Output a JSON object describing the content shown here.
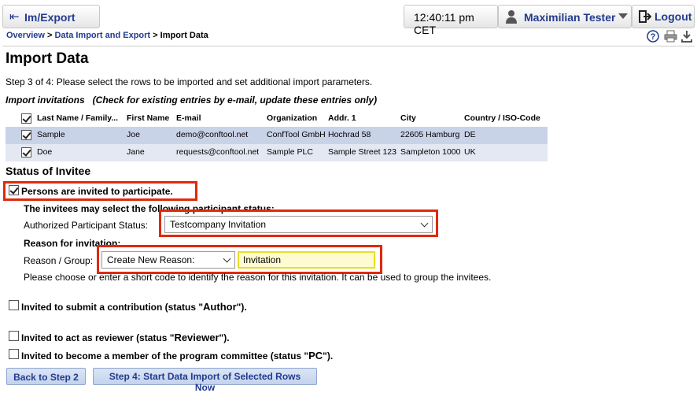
{
  "header": {
    "nav_label": "Im/Export",
    "time": "12:40:11 pm CET",
    "user_name": "Maximilian Tester",
    "logout_label": "Logout"
  },
  "breadcrumb": {
    "item1": "Overview",
    "sep1": " > ",
    "item2": "Data Import and Export",
    "sep2": " > ",
    "current": "Import Data"
  },
  "tools": [
    "help-icon",
    "print-icon",
    "download-icon"
  ],
  "page": {
    "title": "Import Data",
    "step_text": "Step 3 of 4: Please select the rows to be imported and set additional import parameters.",
    "section_title": "Import invitations   (Check for existing entries by e-mail, update these entries only)"
  },
  "table": {
    "columns": [
      "Last Name / Family...",
      "First Name",
      "E-mail",
      "Organization",
      "Addr. 1",
      "City",
      "Country / ISO-Code"
    ],
    "header_checked": true,
    "rows": [
      {
        "checked": true,
        "cells": [
          "Sample",
          "Joe",
          "demo@conftool.net",
          "ConfTool GmbH",
          "Hochrad 58",
          "22605 Hamburg",
          "DE"
        ]
      },
      {
        "checked": true,
        "cells": [
          "Doe",
          "Jane",
          "requests@conftool.net",
          "Sample PLC",
          "Sample Street 123",
          "Sampleton 1000",
          "UK"
        ]
      }
    ]
  },
  "status": {
    "title": "Status of Invitee",
    "participate": {
      "checked": true,
      "label": "Persons are invited to participate."
    },
    "may_select_text": "The invitees may select the following participant status:",
    "authorized_label": "Authorized Participant Status:",
    "authorized_value": "Testcompany Invitation",
    "reason_title": "Reason for invitation:",
    "reason_label": "Reason / Group:",
    "reason_select_value": "Create New Reason:",
    "reason_input_value": "Invitation",
    "reason_help": "Please choose or enter a short code to identify the reason for this invitation. It can be used to group the invitees.",
    "author": {
      "checked": false,
      "prefix": "Invited to submit a contribution (status \"",
      "status": "Author",
      "suffix": "\")."
    },
    "reviewer": {
      "checked": false,
      "prefix": "Invited to act as reviewer (status \"",
      "status": "Reviewer",
      "suffix": "\")."
    },
    "pc": {
      "checked": false,
      "prefix": "Invited to become a member of the program committee (status \"",
      "status": "PC",
      "suffix": "\")."
    }
  },
  "buttons": {
    "back": "Back to Step 2",
    "start": "Step 4: Start Data Import of Selected Rows Now"
  },
  "colors": {
    "link": "#223b8f",
    "highlight_box": "#e0290a",
    "row_odd": "#c9d3e8",
    "row_even": "#e3e8f3",
    "input_highlight": "#e7de2a"
  }
}
